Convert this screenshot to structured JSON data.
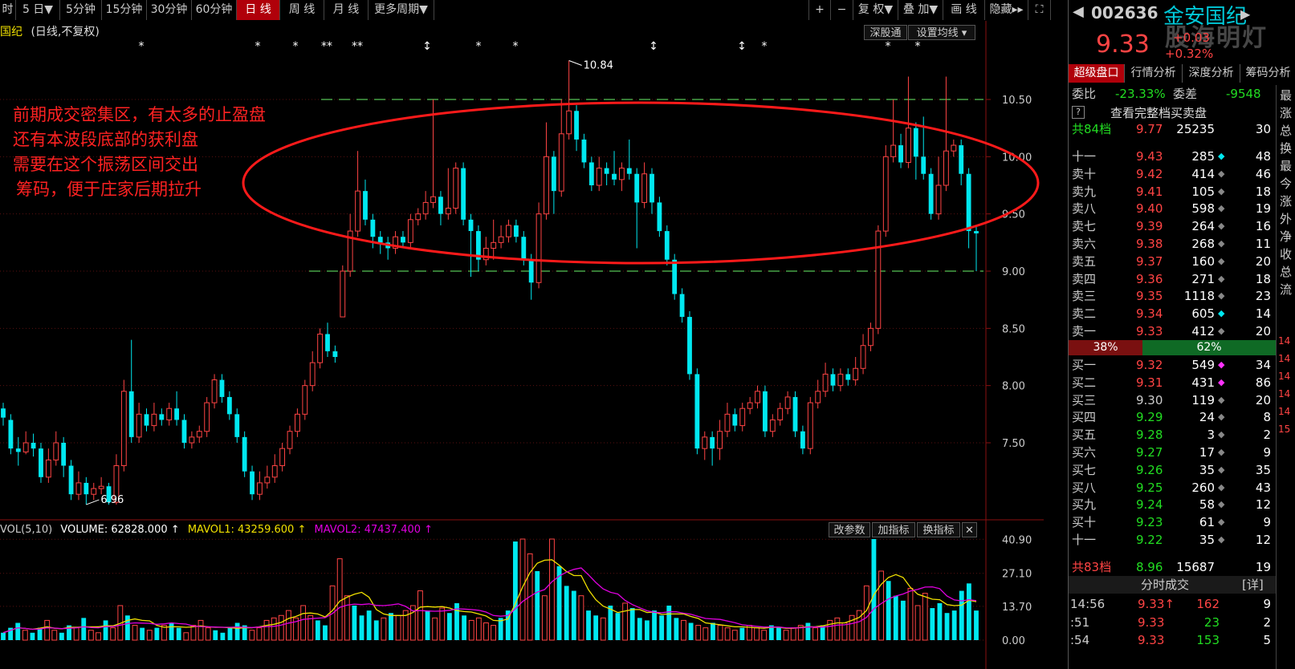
{
  "toolbar": {
    "items": [
      "时",
      "5 日▼",
      "5分钟",
      "15分钟",
      "30分钟",
      "60分钟",
      "日 线",
      "周 线",
      "月 线",
      "更多周期▼"
    ],
    "active_index": 6,
    "right_items": [
      "+",
      "−",
      "复 权▼",
      "叠 加▼",
      "画 线",
      "隐藏▸▸",
      "⛶"
    ]
  },
  "chart_header": {
    "name_prefix": "国纪",
    "period_info": "(日线,不复权)",
    "sgt_button": "深股通",
    "ma_button": "设置均线 ▾"
  },
  "annotation": {
    "lines": [
      "前期成交密集区，有太多的止盈盘",
      "还有本波段底部的获利盘",
      "需要在这个振荡区间交出",
      "筹码，便于庄家后期拉升"
    ],
    "color": "#ff2222"
  },
  "chart_data": {
    "type": "candlestick",
    "price_axis": {
      "ticks": [
        "10.50",
        "10.00",
        "9.50",
        "9.00",
        "8.50",
        "8.00",
        "7.50"
      ],
      "range": [
        6.8,
        11.3
      ]
    },
    "high_label": "10.84",
    "low_label": "6.96",
    "resistance_level": 10.5,
    "support_level": 9.0,
    "candles": [
      [
        7.8,
        7.72,
        7.85,
        7.65
      ],
      [
        7.7,
        7.45,
        7.75,
        7.4
      ],
      [
        7.45,
        7.42,
        7.55,
        7.3
      ],
      [
        7.42,
        7.5,
        7.6,
        7.4
      ],
      [
        7.5,
        7.45,
        7.58,
        7.38
      ],
      [
        7.45,
        7.2,
        7.5,
        7.15
      ],
      [
        7.2,
        7.35,
        7.45,
        7.15
      ],
      [
        7.35,
        7.5,
        7.6,
        7.3
      ],
      [
        7.5,
        7.3,
        7.55,
        7.2
      ],
      [
        7.3,
        7.05,
        7.35,
        7.0
      ],
      [
        7.05,
        7.15,
        7.25,
        7.0
      ],
      [
        7.15,
        7.05,
        7.2,
        6.96
      ],
      [
        7.05,
        7.1,
        7.15,
        7.0
      ],
      [
        7.1,
        7.12,
        7.2,
        7.05
      ],
      [
        7.12,
        6.98,
        7.15,
        6.96
      ],
      [
        6.98,
        7.3,
        7.4,
        6.96
      ],
      [
        7.3,
        7.95,
        8.05,
        7.25
      ],
      [
        7.95,
        7.55,
        8.4,
        7.5
      ],
      [
        7.55,
        7.75,
        7.85,
        7.5
      ],
      [
        7.75,
        7.65,
        7.8,
        7.6
      ],
      [
        7.65,
        7.75,
        7.85,
        7.6
      ],
      [
        7.75,
        7.7,
        7.8,
        7.65
      ],
      [
        7.7,
        7.8,
        7.85,
        7.65
      ],
      [
        7.8,
        7.7,
        7.95,
        7.65
      ],
      [
        7.7,
        7.5,
        7.75,
        7.45
      ],
      [
        7.5,
        7.55,
        7.6,
        7.45
      ],
      [
        7.55,
        7.6,
        7.65,
        7.5
      ],
      [
        7.6,
        7.85,
        7.9,
        7.55
      ],
      [
        7.85,
        8.05,
        8.1,
        7.8
      ],
      [
        8.05,
        7.9,
        8.1,
        7.85
      ],
      [
        7.9,
        7.75,
        7.95,
        7.7
      ],
      [
        7.75,
        7.55,
        7.8,
        7.5
      ],
      [
        7.55,
        7.25,
        7.6,
        7.2
      ],
      [
        7.25,
        7.05,
        7.3,
        7.0
      ],
      [
        7.05,
        7.15,
        7.25,
        7.0
      ],
      [
        7.15,
        7.2,
        7.3,
        7.1
      ],
      [
        7.2,
        7.3,
        7.4,
        7.15
      ],
      [
        7.3,
        7.45,
        7.5,
        7.25
      ],
      [
        7.45,
        7.6,
        7.65,
        7.4
      ],
      [
        7.6,
        7.75,
        7.8,
        7.55
      ],
      [
        7.75,
        8.0,
        8.05,
        7.7
      ],
      [
        8.0,
        8.2,
        8.3,
        7.95
      ],
      [
        8.2,
        8.45,
        8.5,
        8.15
      ],
      [
        8.45,
        8.3,
        8.55,
        8.25
      ],
      [
        8.3,
        8.25,
        8.35,
        8.2
      ],
      [
        8.6,
        9.0,
        9.05,
        8.6
      ],
      [
        9.0,
        9.35,
        9.5,
        8.95
      ],
      [
        9.35,
        9.7,
        10.05,
        9.3
      ],
      [
        9.7,
        9.45,
        9.8,
        9.4
      ],
      [
        9.45,
        9.3,
        9.5,
        9.2
      ],
      [
        9.3,
        9.25,
        9.35,
        9.15
      ],
      [
        9.25,
        9.2,
        9.3,
        9.1
      ],
      [
        9.2,
        9.3,
        9.35,
        9.15
      ],
      [
        9.3,
        9.25,
        9.35,
        9.2
      ],
      [
        9.25,
        9.45,
        9.5,
        9.2
      ],
      [
        9.45,
        9.5,
        9.55,
        9.4
      ],
      [
        9.5,
        9.6,
        9.7,
        9.45
      ],
      [
        9.6,
        9.65,
        10.5,
        9.55
      ],
      [
        9.65,
        9.5,
        9.7,
        9.4
      ],
      [
        9.5,
        9.55,
        9.9,
        9.45
      ],
      [
        9.55,
        9.9,
        9.95,
        9.5
      ],
      [
        9.9,
        9.45,
        9.95,
        9.4
      ],
      [
        9.45,
        9.35,
        9.5,
        8.95
      ],
      [
        9.35,
        9.1,
        9.4,
        9.0
      ],
      [
        9.1,
        9.2,
        9.3,
        9.05
      ],
      [
        9.2,
        9.25,
        9.45,
        9.1
      ],
      [
        9.25,
        9.3,
        9.4,
        9.2
      ],
      [
        9.3,
        9.4,
        9.45,
        9.25
      ],
      [
        9.4,
        9.3,
        9.45,
        9.25
      ],
      [
        9.3,
        9.1,
        9.35,
        9.05
      ],
      [
        9.1,
        8.9,
        9.15,
        8.75
      ],
      [
        8.9,
        9.5,
        9.6,
        8.85
      ],
      [
        9.5,
        10.0,
        10.3,
        9.45
      ],
      [
        10.0,
        9.7,
        10.05,
        9.5
      ],
      [
        9.7,
        10.2,
        10.5,
        9.65
      ],
      [
        10.2,
        10.4,
        10.84,
        10.15
      ],
      [
        10.4,
        10.15,
        10.45,
        10.05
      ],
      [
        10.15,
        9.95,
        10.2,
        9.9
      ],
      [
        9.95,
        9.75,
        10.0,
        9.7
      ],
      [
        9.75,
        9.9,
        10.0,
        9.7
      ],
      [
        9.9,
        9.85,
        9.95,
        9.75
      ],
      [
        9.85,
        9.8,
        10.05,
        9.75
      ],
      [
        9.8,
        9.9,
        9.95,
        9.7
      ],
      [
        9.9,
        9.85,
        10.15,
        9.8
      ],
      [
        9.85,
        9.6,
        9.9,
        9.2
      ],
      [
        9.6,
        9.85,
        9.95,
        9.55
      ],
      [
        9.85,
        9.6,
        9.9,
        9.5
      ],
      [
        9.6,
        9.35,
        9.65,
        9.3
      ],
      [
        9.35,
        9.1,
        9.4,
        9.05
      ],
      [
        9.1,
        8.8,
        9.15,
        8.75
      ],
      [
        8.8,
        8.6,
        8.85,
        8.55
      ],
      [
        8.6,
        8.1,
        8.65,
        8.05
      ],
      [
        8.1,
        7.45,
        8.15,
        7.4
      ],
      [
        7.45,
        7.55,
        7.6,
        7.35
      ],
      [
        7.55,
        7.45,
        7.6,
        7.3
      ],
      [
        7.45,
        7.6,
        7.7,
        7.35
      ],
      [
        7.6,
        7.75,
        7.85,
        7.55
      ],
      [
        7.75,
        7.65,
        7.8,
        7.6
      ],
      [
        7.65,
        7.8,
        7.85,
        7.6
      ],
      [
        7.8,
        7.85,
        7.9,
        7.75
      ],
      [
        7.85,
        7.95,
        8.0,
        7.8
      ],
      [
        7.95,
        7.6,
        8.0,
        7.55
      ],
      [
        7.6,
        7.7,
        7.75,
        7.55
      ],
      [
        7.7,
        7.8,
        7.85,
        7.65
      ],
      [
        7.8,
        7.9,
        7.95,
        7.75
      ],
      [
        7.9,
        7.6,
        7.95,
        7.55
      ],
      [
        7.6,
        7.45,
        7.65,
        7.4
      ],
      [
        7.45,
        7.85,
        7.9,
        7.4
      ],
      [
        7.85,
        7.95,
        8.05,
        7.8
      ],
      [
        7.95,
        8.1,
        8.2,
        7.9
      ],
      [
        8.1,
        8.0,
        8.15,
        7.95
      ],
      [
        8.0,
        8.1,
        8.15,
        7.95
      ],
      [
        8.1,
        8.05,
        8.15,
        8.0
      ],
      [
        8.05,
        8.15,
        8.25,
        8.0
      ],
      [
        8.15,
        8.35,
        8.45,
        8.1
      ],
      [
        8.35,
        8.5,
        8.55,
        8.3
      ],
      [
        8.5,
        9.35,
        9.4,
        8.45
      ],
      [
        9.35,
        10.0,
        10.1,
        9.3
      ],
      [
        10.0,
        10.1,
        10.5,
        9.95
      ],
      [
        10.1,
        9.95,
        10.2,
        9.9
      ],
      [
        9.95,
        10.25,
        10.7,
        9.9
      ],
      [
        10.25,
        10.0,
        10.3,
        9.8
      ],
      [
        10.0,
        9.85,
        10.35,
        9.8
      ],
      [
        9.85,
        9.5,
        9.9,
        9.45
      ],
      [
        9.5,
        9.75,
        10.0,
        9.45
      ],
      [
        9.75,
        10.05,
        10.7,
        9.7
      ],
      [
        10.05,
        10.1,
        10.15,
        10.0
      ],
      [
        10.1,
        9.85,
        10.15,
        9.75
      ],
      [
        9.85,
        9.35,
        9.9,
        9.2
      ],
      [
        9.35,
        9.33,
        9.4,
        9.0
      ]
    ],
    "markers": [
      "*",
      "*",
      "*",
      "**",
      "**",
      "↕",
      "*",
      "*",
      "↕",
      "↕",
      "*",
      "*",
      "*"
    ],
    "volume": {
      "indicator": "VOL(5,10)",
      "volume_label": "VOLUME: 62828.000",
      "mavol1_label": "MAVOL1: 43259.600",
      "mavol2_label": "MAVOL2: 47437.400",
      "ticks": [
        "40.90",
        "27.10",
        "13.70",
        "0.00"
      ],
      "range": [
        0,
        41
      ],
      "bars": [
        3,
        5,
        7,
        4,
        3,
        5,
        8,
        4,
        3,
        6,
        5,
        9,
        4,
        3,
        8,
        5,
        14,
        10,
        6,
        5,
        4,
        5,
        6,
        7,
        5,
        3,
        6,
        8,
        5,
        4,
        3,
        5,
        7,
        6,
        4,
        5,
        8,
        9,
        10,
        12,
        9,
        14,
        10,
        8,
        6,
        22,
        33,
        18,
        14,
        10,
        12,
        8,
        9,
        11,
        10,
        12,
        14,
        20,
        12,
        9,
        13,
        11,
        15,
        10,
        8,
        9,
        7,
        6,
        9,
        12,
        40,
        41,
        35,
        28,
        18,
        41,
        30,
        22,
        20,
        18,
        12,
        10,
        9,
        14,
        11,
        15,
        13,
        9,
        8,
        12,
        10,
        14,
        9,
        8,
        7,
        6,
        5,
        7,
        6,
        5,
        4,
        5,
        6,
        5,
        4,
        6,
        5,
        4,
        5,
        6,
        7,
        5,
        6,
        8,
        9,
        7,
        10,
        12,
        22,
        41,
        28,
        24,
        18,
        16,
        21,
        14,
        19,
        13,
        15,
        11,
        12,
        20,
        23,
        12
      ]
    },
    "mavol1_color": "#f0e000",
    "mavol2_color": "#e000e0",
    "up_color": "#ff4444",
    "down_color": "#00e8f0"
  },
  "vol_buttons": [
    "改参数",
    "加指标",
    "换指标",
    "✕"
  ],
  "quote": {
    "code": "002636",
    "name": "金安国纪",
    "price": "9.33",
    "change": "+0.03",
    "change_pct": "+0.32%",
    "watermark": "股海明灯",
    "tabs": [
      "超级盘口",
      "行情分析",
      "深度分析",
      "筹码分析"
    ],
    "weibi_label": "委比",
    "weibi_value": "-23.33%",
    "weicha_label": "委差",
    "weicha_value": "-9548",
    "full_book_label": "查看完整档买卖盘",
    "sell_total": {
      "label": "共84档",
      "price": "9.77",
      "vol": "25235",
      "n": "30"
    },
    "sells": [
      {
        "label": "十一",
        "price": "9.43",
        "vol": "285",
        "n": "48",
        "mark": "◆",
        "mc": "#00e8f0"
      },
      {
        "label": "卖十",
        "price": "9.42",
        "vol": "414",
        "n": "46",
        "mark": "◆",
        "mc": "#888"
      },
      {
        "label": "卖九",
        "price": "9.41",
        "vol": "105",
        "n": "18",
        "mark": "◆",
        "mc": "#888"
      },
      {
        "label": "卖八",
        "price": "9.40",
        "vol": "598",
        "n": "19",
        "mark": "◆",
        "mc": "#888"
      },
      {
        "label": "卖七",
        "price": "9.39",
        "vol": "264",
        "n": "16",
        "mark": "◆",
        "mc": "#888"
      },
      {
        "label": "卖六",
        "price": "9.38",
        "vol": "268",
        "n": "11",
        "mark": "◆",
        "mc": "#888"
      },
      {
        "label": "卖五",
        "price": "9.37",
        "vol": "160",
        "n": "20",
        "mark": "◆",
        "mc": "#888"
      },
      {
        "label": "卖四",
        "price": "9.36",
        "vol": "271",
        "n": "18",
        "mark": "◆",
        "mc": "#888"
      },
      {
        "label": "卖三",
        "price": "9.35",
        "vol": "1118",
        "n": "23",
        "mark": "◆",
        "mc": "#888"
      },
      {
        "label": "卖二",
        "price": "9.34",
        "vol": "605",
        "n": "14",
        "mark": "◆",
        "mc": "#00e8f0"
      },
      {
        "label": "卖一",
        "price": "9.33",
        "vol": "412",
        "n": "20",
        "mark": "◆",
        "mc": "#888"
      }
    ],
    "ratio_sell": "38%",
    "ratio_buy": "62%",
    "buys": [
      {
        "label": "买一",
        "price": "9.32",
        "vol": "549",
        "n": "34",
        "mark": "◆",
        "mc": "#ff33ff",
        "pc": "#ff4444"
      },
      {
        "label": "买二",
        "price": "9.31",
        "vol": "431",
        "n": "86",
        "mark": "◆",
        "mc": "#ff33ff",
        "pc": "#ff4444"
      },
      {
        "label": "买三",
        "price": "9.30",
        "vol": "119",
        "n": "20",
        "mark": "◆",
        "mc": "#888",
        "pc": "#ccc"
      },
      {
        "label": "买四",
        "price": "9.29",
        "vol": "24",
        "n": "8",
        "mark": "◆",
        "mc": "#888",
        "pc": "#22dd22"
      },
      {
        "label": "买五",
        "price": "9.28",
        "vol": "3",
        "n": "2",
        "mark": "◆",
        "mc": "#888",
        "pc": "#22dd22"
      },
      {
        "label": "买六",
        "price": "9.27",
        "vol": "17",
        "n": "9",
        "mark": "◆",
        "mc": "#888",
        "pc": "#22dd22"
      },
      {
        "label": "买七",
        "price": "9.26",
        "vol": "35",
        "n": "35",
        "mark": "◆",
        "mc": "#888",
        "pc": "#22dd22"
      },
      {
        "label": "买八",
        "price": "9.25",
        "vol": "260",
        "n": "43",
        "mark": "◆",
        "mc": "#888",
        "pc": "#22dd22"
      },
      {
        "label": "买九",
        "price": "9.24",
        "vol": "58",
        "n": "12",
        "mark": "◆",
        "mc": "#888",
        "pc": "#22dd22"
      },
      {
        "label": "买十",
        "price": "9.23",
        "vol": "61",
        "n": "9",
        "mark": "◆",
        "mc": "#888",
        "pc": "#22dd22"
      },
      {
        "label": "十一",
        "price": "9.22",
        "vol": "35",
        "n": "12",
        "mark": "◆",
        "mc": "#888",
        "pc": "#22dd22"
      }
    ],
    "buy_total": {
      "label": "共83档",
      "price": "8.96",
      "vol": "15687",
      "n": "19"
    },
    "ticks_title": "分时成交",
    "ticks_detail": "[详]",
    "ticks": [
      {
        "time": "14:56",
        "price": "9.33↑",
        "vol": "162",
        "n": "9",
        "vc": "#ff4444"
      },
      {
        "time": ":51",
        "price": "9.33",
        "vol": "23",
        "n": "2",
        "vc": "#22dd22"
      },
      {
        "time": ":54",
        "price": "9.33",
        "vol": "153",
        "n": "5",
        "vc": "#22dd22"
      }
    ],
    "edge_chars": [
      "最",
      "涨",
      "总",
      "换",
      "最",
      "今",
      "涨",
      "外",
      "净",
      "收",
      "总",
      "流"
    ],
    "edge_nums": [
      "14",
      "14",
      "14",
      "14",
      "14",
      "15"
    ]
  }
}
